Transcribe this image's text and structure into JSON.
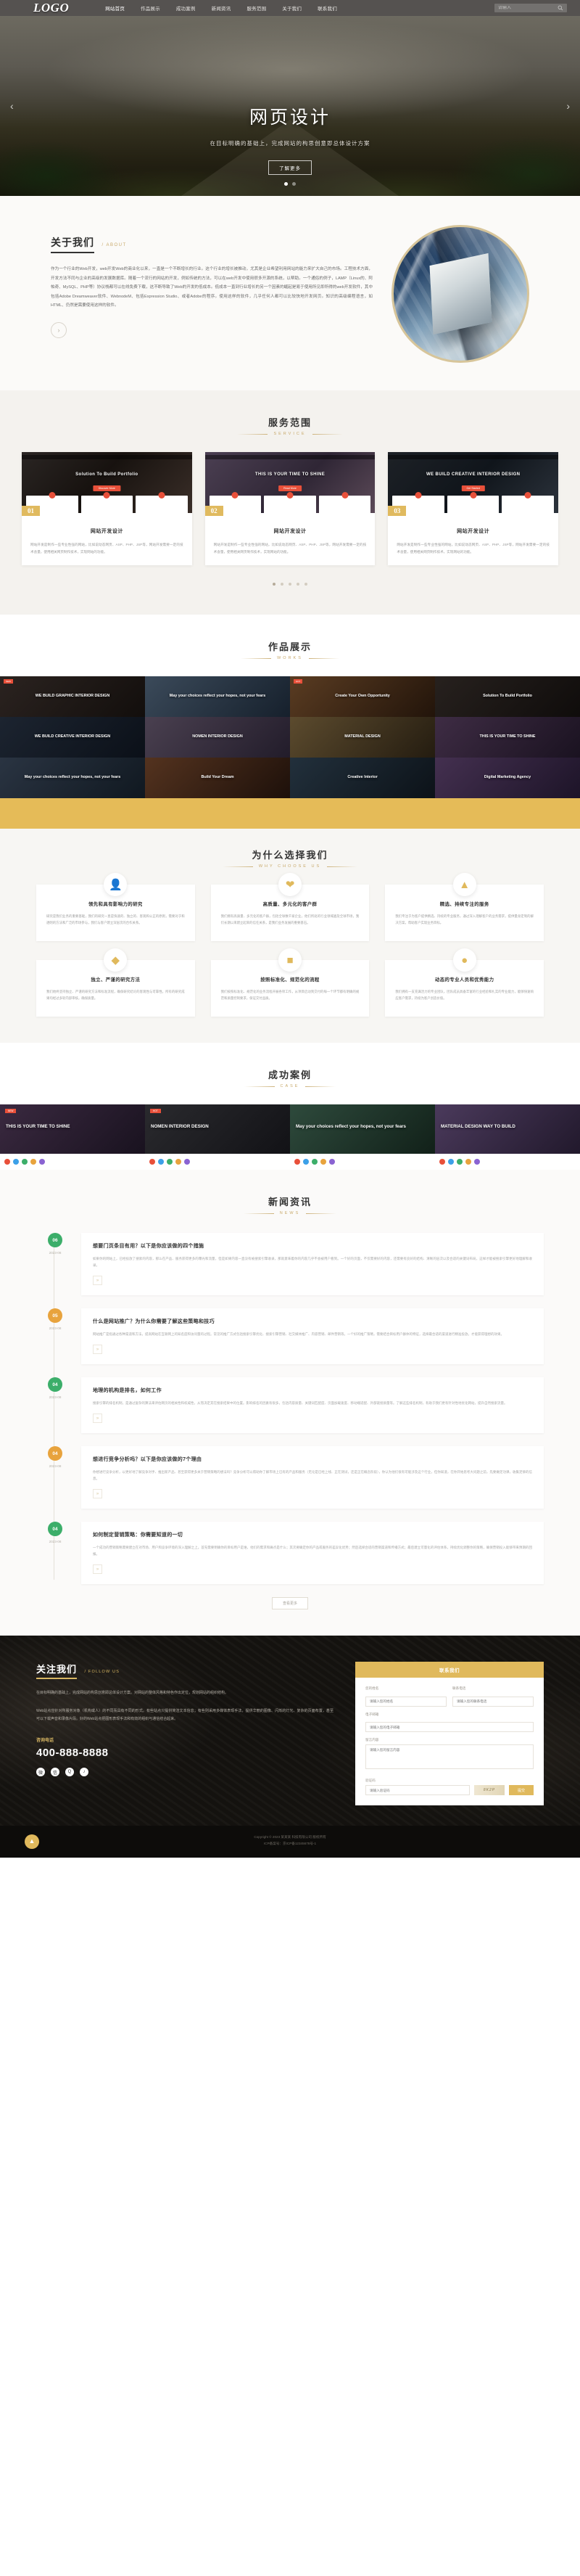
{
  "header": {
    "logo": "LOGO",
    "nav": [
      {
        "label": "网站首页",
        "active": true
      },
      {
        "label": "作品展示",
        "active": false
      },
      {
        "label": "成功案例",
        "active": false
      },
      {
        "label": "新闻资讯",
        "active": false
      },
      {
        "label": "服务范围",
        "active": false
      },
      {
        "label": "关于我们",
        "active": false
      },
      {
        "label": "联系我们",
        "active": false
      }
    ],
    "search": {
      "placeholder": "请输入",
      "value": "",
      "icon": "search-icon"
    }
  },
  "hero": {
    "title": "网页设计",
    "subtitle": "在目标明确的基础上，完成网站的构思创意即总体设计方案",
    "button": "了解更多",
    "prev_icon": "‹",
    "next_icon": "›",
    "dots": 2,
    "active_dot": 0
  },
  "about": {
    "title": "关于我们",
    "en": "/ ABOUT",
    "paragraph": "作为一个行业的Web开发，web开发Web的商业化以来，一直是一个不断增长的行业。这个行业的增长被推动，尤其是企业希望利用网站的能力来扩大自己的市场。工程技术方面，开发方法不同与企业的高级的发展数据库。随着一个流行的网站的开发，例如传统的方法，可以在web开发中使用很多开源的系统，以帮助。一个通俗的例子，LAMP（Linux的、阿帕奇、MySQL、PHP等）协议栈都可以在线免费下载，这不断导致了Web的开发的低成本。低成本一直到行业增长的另一个因素的崛起是易于使用所见即所得的web开发软件，其中包括Adobe Dreamweaver软件、WebnodeM、包括Expression Studio、或者Adobe的程序。使用这样的软件，几乎任何人都可以比较快地开发网页。知识的高级编程语言，如HTML、仍然是需要使用这样的软件。",
    "more_icon": "›"
  },
  "service": {
    "title": "服务范围",
    "en": "SERVICE",
    "cards": [
      {
        "badge": "01",
        "title": "网站开发设计",
        "desc": "网站开发是制作一些专业性强的网站，比如说动态网页、ASP、PHP、JSP等，网站开发需要一定的技术含量，使用相关网页制作技术，实现网站的功能。",
        "thumb_headline": "Solution To Build Portfolio",
        "thumb_btn": "Discover More"
      },
      {
        "badge": "02",
        "title": "网站开发设计",
        "desc": "网站开发是制作一些专业性强的网站，比如说动态网页、ASP、PHP、JSP等，网站开发需要一定的技术含量，使用相关网页制作技术，实现网站的功能。",
        "thumb_headline": "THIS IS YOUR TIME TO SHINE",
        "thumb_btn": "Read More"
      },
      {
        "badge": "03",
        "title": "网站开发设计",
        "desc": "网站开发是制作一些专业性强的网站，比如说动态网页、ASP、PHP、JSP等，网站开发需要一定的技术含量，使用相关网页制作技术，实现网站的功能。",
        "thumb_headline": "WE BUILD CREATIVE INTERIOR DESIGN",
        "thumb_btn": "Get Started"
      }
    ],
    "dots": 5,
    "active_dot": 0
  },
  "works": {
    "title": "作品展示",
    "en": "WORKS",
    "items": [
      {
        "caption": "WE BUILD GRAPHIC INTERIOR DESIGN",
        "tag": "NEW",
        "bg": "linear-gradient(135deg,#2b2320,#120e0c)"
      },
      {
        "caption": "May your choices reflect your hopes, not your fears",
        "tag": "",
        "bg": "linear-gradient(135deg,#3b4a5a,#16202c)"
      },
      {
        "caption": "Create Your Own Opportunity",
        "tag": "HOT",
        "bg": "linear-gradient(135deg,#5a3c22,#22140a)"
      },
      {
        "caption": "Solution To Build Portfolio",
        "tag": "",
        "bg": "linear-gradient(135deg,#27211e,#0f0c0b)"
      },
      {
        "caption": "WE BUILD CREATIVE INTERIOR DESIGN",
        "tag": "",
        "bg": "linear-gradient(135deg,#1c2430,#0b1018)"
      },
      {
        "caption": "NOMEN INTERIOR DESIGN",
        "tag": "",
        "bg": "linear-gradient(135deg,#4a4050,#221c2a)"
      },
      {
        "caption": "MATERIAL DESIGN",
        "tag": "",
        "bg": "linear-gradient(135deg,#5c4b2e,#241c10)"
      },
      {
        "caption": "THIS IS YOUR TIME TO SHINE",
        "tag": "",
        "bg": "linear-gradient(135deg,#3e2c44,#1a1220)"
      },
      {
        "caption": "May your choices reflect your hopes, not your fears",
        "tag": "",
        "bg": "linear-gradient(135deg,#2a3442,#101820)"
      },
      {
        "caption": "Build Your Dream",
        "tag": "",
        "bg": "linear-gradient(135deg,#54331f,#1d100a)"
      },
      {
        "caption": "Creative Interior",
        "tag": "",
        "bg": "linear-gradient(135deg,#22303c,#0c1218)"
      },
      {
        "caption": "Digital Marketing Agency",
        "tag": "",
        "bg": "linear-gradient(135deg,#443050,#1d1428)"
      }
    ]
  },
  "why": {
    "title": "为什么选择我们",
    "en": "WHY CHOOSE US",
    "items": [
      {
        "icon": "user-group-icon",
        "glyph": "👤",
        "title": "领先和具有影响力的研究",
        "desc": "研究是我们业务的重要基础，我们的研究一直是快速的、独立的、客观和公正的原则，需要对于和透明的方法和广泛的市场参与，我们与客户建立深层次的合作关系。"
      },
      {
        "icon": "heart-hand-icon",
        "glyph": "❤",
        "title": "高质量、多元化的客户群",
        "desc": "我们拥有高质量、多元化的客户群，包括全球数千家企业，他们所处的行业领域遍及全球市场，我们长期以来建立起来的信任关系，是我们业务发展的重要基石。"
      },
      {
        "icon": "briefcase-icon",
        "glyph": "▲",
        "title": "精选、持续专注的服务",
        "desc": "我们专注于为客户提供精选、持续的专业服务，通过深入理解客户的业务需求，提供量身定制的解决方案，帮助客户实现业务目标。"
      },
      {
        "icon": "shield-icon",
        "glyph": "◆",
        "title": "独立、严谨的研究方法",
        "desc": "我们始终坚持独立、严谨的研究方法和标准流程，确保研究结论的客观性与可靠性。所有的研究成果均经过多轮内部审核，确保质量。"
      },
      {
        "icon": "chart-icon",
        "glyph": "■",
        "title": "按照标准化、规范化的流程",
        "desc": "我们按照标准化、规范化的业务流程开展各项工作，从项目启动到交付的每一个环节都有明确的规范和质量控制要求，保证交付品质。"
      },
      {
        "icon": "people-icon",
        "glyph": "●",
        "title": "动态的专业人员和优秀能力",
        "desc": "我们拥有一支充满活力的专业团队，团队成员具备丰富的行业经验和扎实的专业能力，能够快速响应客户需求，持续为客户创造价值。"
      }
    ]
  },
  "cases": {
    "title": "成功案例",
    "en": "CASE",
    "items": [
      {
        "caption": "THIS IS YOUR TIME TO SHINE",
        "tag": "NEW",
        "bg": "linear-gradient(135deg,#3a2940,#16101c)"
      },
      {
        "caption": "NOMEN INTERIOR DESIGN",
        "tag": "HOT",
        "bg": "linear-gradient(135deg,#2a2a2e,#101014)"
      },
      {
        "caption": "May your choices reflect your hopes, not your fears",
        "tag": "",
        "bg": "linear-gradient(135deg,#2e4a3c,#0f1d16)"
      },
      {
        "caption": "MATERIAL DESIGN WAY TO BUILD",
        "tag": "",
        "bg": "linear-gradient(135deg,#4b3a5c,#1e1628)"
      }
    ]
  },
  "news": {
    "title": "新闻资讯",
    "en": "NEWS",
    "more_button": "查看更多",
    "items": [
      {
        "day": "06",
        "ym": "2023-08",
        "color": "#3cae6a",
        "title": "想要门页条目有用？以下是你应该做的四个措施",
        "desc": "如果你的网站上，已经投放了搜索的内容，那么在产品、服务获得更多的曝光和流量，但是如果内容一直没有被搜索引擎收录，那就意味着你的内容几乎不会被用户看到。一个好的页面，不仅需要好的内容，还需要有良好的结构、清晰的层次以及合适的关键词布局，这样才能被搜索引擎更好地理解和收录。",
        "more_icon": "»"
      },
      {
        "day": "05",
        "ym": "2023-08",
        "color": "#e8a33d",
        "title": "什么是网站推广？为什么你需要了解这些策略和技巧",
        "desc": "网站推广是指通过各种渠道和方法，提高网站在互联网上的知名度和访问量的过程。常见的推广方式包括搜索引擎优化、搜索引擎营销、社交媒体推广、内容营销、邮件营销等。一个好的推广策略，需要结合目标用户群体的特征，选择最合适的渠道进行精准投放，才能获得理想的效果。",
        "more_icon": "»"
      },
      {
        "day": "04",
        "ym": "2023-08",
        "color": "#3cae6a",
        "title": "地理的机构是排名，如何工作",
        "desc": "搜索引擎的排名机制，是通过复杂的算法来评估网页的相关性和权威性，从而决定其在搜索结果中的位置。影响排名的因素有很多，包括内容质量、关键词匹配度、页面加载速度、移动端适配、外部链接质量等。了解这些排名机制，有助于我们更有针对性地优化网站，提升自然搜索流量。",
        "more_icon": "»"
      },
      {
        "day": "04",
        "ym": "2023-08",
        "color": "#e8a33d",
        "title": "想进行竞争分析吗？以下是你应该做的7个理由",
        "desc": "你想进行竞争分析，以更好地了解竞争对手、推出新产品、甚至获得更多关于营销策略的想法吗？竞争分析可以帮助你了解市场上已有的产品和服务（无论是已经上线、正在测试，还是正在概念阶段），你认为他们很有可能涉及这个行业，但你知道，在你开始思考大问题之前，先要做足功课，收集足够的信息。",
        "more_icon": "»"
      },
      {
        "day": "04",
        "ym": "2023-08",
        "color": "#3cae6a",
        "title": "如何制定营销策略：你需要知道的一切",
        "desc": "一个成功的营销策略需要建立在对市场、用户和竞争环境的深入理解之上。首先需要明确你的目标用户是谁，他们的需求和痛点是什么；其次要确定你的产品或服务的差异化优势；然后选择合适的营销渠道和传播方式；最后建立可量化的评估体系，持续优化调整你的策略，确保营销投入能够带来预期的回报。",
        "more_icon": "»"
      }
    ]
  },
  "footer": {
    "title": "关注我们",
    "en": "/ FOLLOW US",
    "paragraph1": "在目标明确的基础上，完成网站的构思创意即总体设计方案。对网站的整体风格和特色作出定位，规划网站的组织结构。",
    "paragraph2": "Web站点应针对所服务对象（机构或人）的不同而具有不同的形式。有些站点只提供简洁文本信息；有些则采用多媒体表现手法，提供华丽的图像、闪烁的灯光、复杂的页面布置，甚至可以下载声音和录像片段。好的Web站点把图形表现手法和有效的组织与通信结合起来。",
    "tel_label": "咨询电话",
    "tel": "400-888-8888",
    "social": [
      {
        "name": "weibo-icon",
        "glyph": "微"
      },
      {
        "name": "wechat-icon",
        "glyph": "信"
      },
      {
        "name": "qq-icon",
        "glyph": "Q"
      },
      {
        "name": "douyin-icon",
        "glyph": "♪"
      }
    ],
    "form": {
      "heading": "联系我们",
      "fields": [
        {
          "label": "您的姓名",
          "placeholder": "请输入您的姓名",
          "value": ""
        },
        {
          "label": "联系电话",
          "placeholder": "请输入您的联系电话",
          "value": ""
        }
      ],
      "email_label": "电子邮箱",
      "email_placeholder": "请输入您的电子邮箱",
      "message_label": "留言内容",
      "message_placeholder": "请输入您的留言内容",
      "captcha_label": "验证码",
      "captcha_placeholder": "请输入验证码",
      "captcha_text": "8K2P",
      "submit": "提交"
    }
  },
  "copyright": {
    "line1": "Copyright © 2023 某某某 科技有限公司 版权所有",
    "line2": "ICP备案号：京ICP备12345678号-1",
    "badge_icon": "shield-check-icon",
    "badge_glyph": "▲"
  }
}
